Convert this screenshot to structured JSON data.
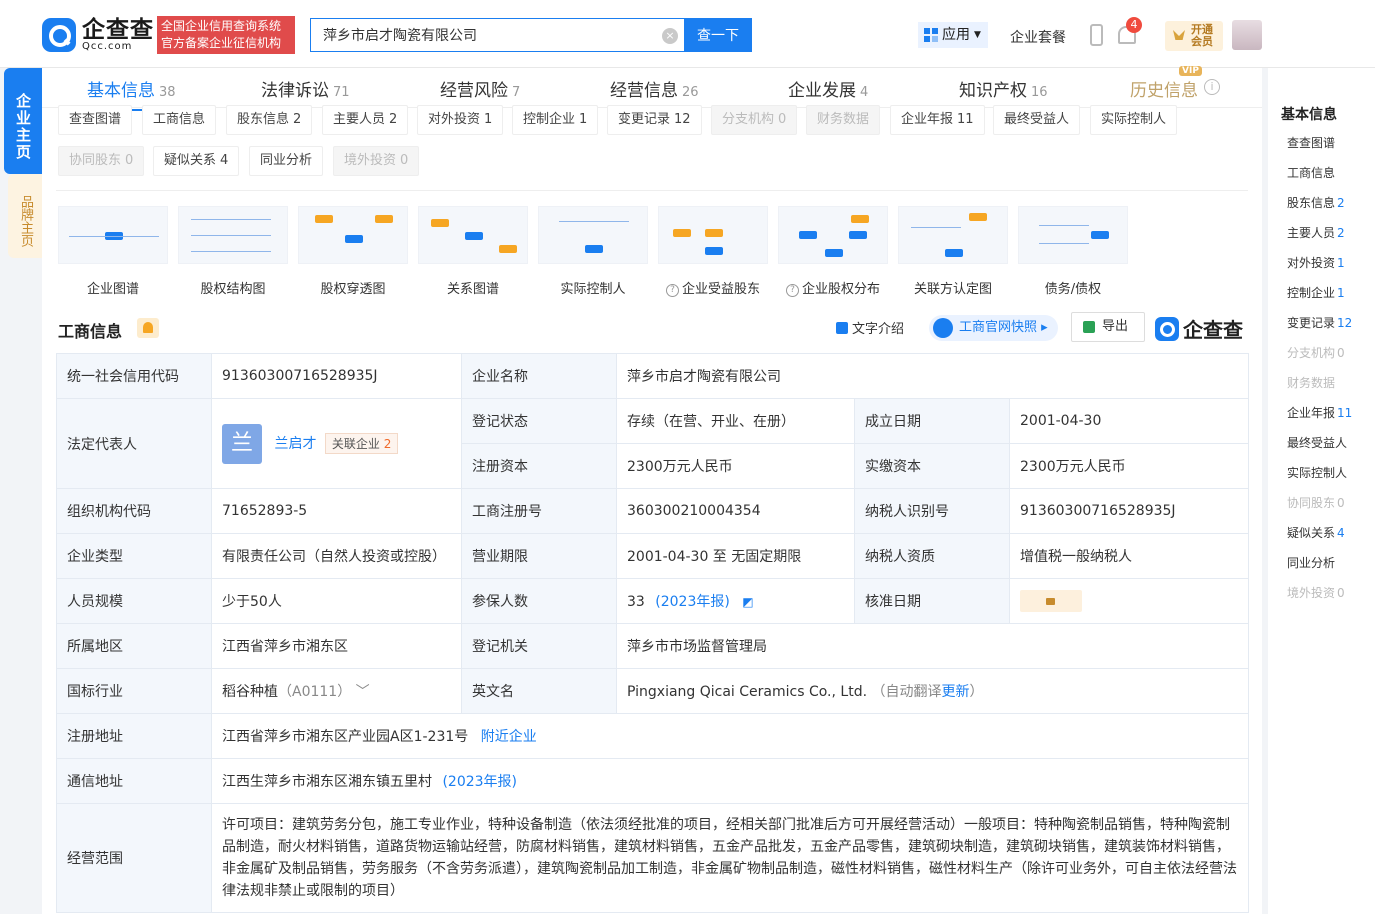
{
  "header": {
    "logo_cn": "企查查",
    "logo_en": "Qcc.com",
    "badge_line1": "全国企业信用查询系统",
    "badge_line2": "官方备案企业征信机构",
    "search_value": "萍乡市启才陶瓷有限公司",
    "search_button": "查一下",
    "app_label": "应用",
    "package_label": "企业套餐",
    "notification_count": "4",
    "vip_line1": "开通",
    "vip_line2": "会员"
  },
  "side_tabs": {
    "main": "企业主页",
    "brand": "品牌主页"
  },
  "top_tabs": [
    {
      "label": "基本信息",
      "count": "38"
    },
    {
      "label": "法律诉讼",
      "count": "71"
    },
    {
      "label": "经营风险",
      "count": "7"
    },
    {
      "label": "经营信息",
      "count": "26"
    },
    {
      "label": "企业发展",
      "count": "4"
    },
    {
      "label": "知识产权",
      "count": "16"
    },
    {
      "label": "历史信息",
      "count": ""
    }
  ],
  "vip_tag": "VIP",
  "chips_row1": [
    {
      "label": "查查图谱",
      "count": ""
    },
    {
      "label": "工商信息",
      "count": ""
    },
    {
      "label": "股东信息",
      "count": "2"
    },
    {
      "label": "主要人员",
      "count": "2"
    },
    {
      "label": "对外投资",
      "count": "1"
    },
    {
      "label": "控制企业",
      "count": "1"
    },
    {
      "label": "变更记录",
      "count": "12"
    },
    {
      "label": "分支机构",
      "count": "0"
    },
    {
      "label": "财务数据",
      "count": ""
    },
    {
      "label": "企业年报",
      "count": "11"
    },
    {
      "label": "最终受益人",
      "count": ""
    },
    {
      "label": "实际控制人",
      "count": ""
    }
  ],
  "chips_row2": [
    {
      "label": "协同股东",
      "count": "0"
    },
    {
      "label": "疑似关系",
      "count": "4"
    },
    {
      "label": "同业分析",
      "count": ""
    },
    {
      "label": "境外投资",
      "count": "0"
    }
  ],
  "graphs": [
    {
      "label": "企业图谱"
    },
    {
      "label": "股权结构图"
    },
    {
      "label": "股权穿透图"
    },
    {
      "label": "关系图谱"
    },
    {
      "label": "实际控制人"
    },
    {
      "label": "企业受益股东"
    },
    {
      "label": "企业股权分布"
    },
    {
      "label": "关联方认定图"
    },
    {
      "label": "债务/债权"
    }
  ],
  "section": {
    "title": "工商信息",
    "text_intro": "文字介绍",
    "snapshot": "工商官网快照",
    "export": "导出",
    "brand": "企查查"
  },
  "info": {
    "credit_code_label": "统一社会信用代码",
    "credit_code": "91360300716528935J",
    "company_name_label": "企业名称",
    "company_name": "萍乡市启才陶瓷有限公司",
    "legal_rep_label": "法定代表人",
    "legal_rep_avatar": "兰",
    "legal_rep": "兰启才",
    "related_label": "关联企业",
    "related_count": "2",
    "reg_status_label": "登记状态",
    "reg_status": "存续（在营、开业、在册）",
    "found_date_label": "成立日期",
    "found_date": "2001-04-30",
    "reg_capital_label": "注册资本",
    "reg_capital": "2300万元人民币",
    "paid_capital_label": "实缴资本",
    "paid_capital": "2300万元人民币",
    "org_code_label": "组织机构代码",
    "org_code": "71652893-5",
    "reg_no_label": "工商注册号",
    "reg_no": "360300210004354",
    "taxpayer_id_label": "纳税人识别号",
    "taxpayer_id": "91360300716528935J",
    "company_type_label": "企业类型",
    "company_type": "有限责任公司（自然人投资或控股）",
    "term_label": "营业期限",
    "term": "2001-04-30 至 无固定期限",
    "taxpayer_qual_label": "纳税人资质",
    "taxpayer_qual": "增值税一般纳税人",
    "staff_size_label": "人员规模",
    "staff_size": "少于50人",
    "insured_label": "参保人数",
    "insured": "33",
    "insured_year": "(2023年报)",
    "approve_date_label": "核准日期",
    "region_label": "所属地区",
    "region": "江西省萍乡市湘东区",
    "reg_authority_label": "登记机关",
    "reg_authority": "萍乡市市场监督管理局",
    "industry_label": "国标行业",
    "industry": "稻谷种植",
    "industry_code": "（A0111）",
    "english_name_label": "英文名",
    "english_name": "Pingxiang Qicai Ceramics Co., Ltd.",
    "auto_translate": "（自动翻译",
    "update_link": "更新",
    "paren_close": "）",
    "reg_address_label": "注册地址",
    "reg_address": "江西省萍乡市湘东区产业园A区1-231号",
    "nearby": "附近企业",
    "mail_address_label": "通信地址",
    "mail_address": "江西生萍乡市湘东区湘东镇五里村",
    "mail_year": "(2023年报)",
    "scope_label": "经营范围",
    "scope": "许可项目：建筑劳务分包，施工专业作业，特种设备制造（依法须经批准的项目，经相关部门批准后方可开展经营活动）一般项目：特种陶瓷制品销售，特种陶瓷制品制造，耐火材料销售，道路货物运输站经营，防腐材料销售，建筑材料销售，五金产品批发，五金产品零售，建筑砌块制造，建筑砌块销售，建筑装饰材料销售，非金属矿及制品销售，劳务服务（不含劳务派遣），建筑陶瓷制品加工制造，非金属矿物制品制造，磁性材料销售，磁性材料生产（除许可业务外，可自主依法经营法律法规非禁止或限制的项目）"
  },
  "right_nav": {
    "title": "基本信息",
    "items": [
      {
        "label": "查查图谱",
        "count": ""
      },
      {
        "label": "工商信息",
        "count": ""
      },
      {
        "label": "股东信息",
        "count": "2"
      },
      {
        "label": "主要人员",
        "count": "2"
      },
      {
        "label": "对外投资",
        "count": "1"
      },
      {
        "label": "控制企业",
        "count": "1"
      },
      {
        "label": "变更记录",
        "count": "12"
      },
      {
        "label": "分支机构",
        "count": "0"
      },
      {
        "label": "财务数据",
        "count": ""
      },
      {
        "label": "企业年报",
        "count": "11"
      },
      {
        "label": "最终受益人",
        "count": ""
      },
      {
        "label": "实际控制人",
        "count": ""
      },
      {
        "label": "协同股东",
        "count": "0"
      },
      {
        "label": "疑似关系",
        "count": "4"
      },
      {
        "label": "同业分析",
        "count": ""
      },
      {
        "label": "境外投资",
        "count": "0"
      }
    ]
  },
  "colors": {
    "brand_blue": "#1a7ef0",
    "badge_red": "#e04b4b",
    "label_bg": "#f3f7fc",
    "vip_gold": "#c78b2d"
  }
}
